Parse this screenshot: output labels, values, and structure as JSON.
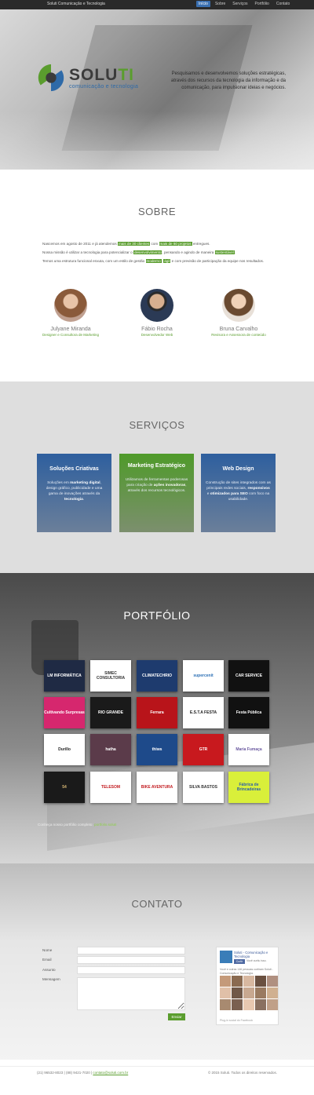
{
  "navbar": {
    "brand": "Soluti Comunicação e Tecnologia",
    "items": [
      "Início",
      "Sobre",
      "Serviços",
      "Portfólio",
      "Contato"
    ],
    "active_index": 0
  },
  "hero": {
    "logo_name_main": "SOLU",
    "logo_name_accent": "TI",
    "logo_tagline": "comunicação e tecnologia",
    "tagline": "Pesquisamos e desenvolvemos soluções estratégicas, através dos recursos da tecnologia da informação e da comunicação, para impulsionar ideias e negócios."
  },
  "sobre": {
    "title": "SOBRE",
    "p1_a": "Nascemos em agosto de 2011 e já atendemos ",
    "p1_hl1": "mais de 30 clientes",
    "p1_b": " com ",
    "p1_hl2": "mais de 60 projetos",
    "p1_c": " entregues.",
    "p2_a": "Nossa missão é utilizar a tecnologia para potencializar o ",
    "p2_hl1": "desenvolvimento",
    "p2_b": ", pensando e agindo de maneira ",
    "p2_hl2": "sustentável",
    "p2_c": ".",
    "p3_a": "Temos uma estrutura funcional enxuta, com um estilo de gestão ",
    "p3_hl1": "moderno",
    "p3_b": ", ",
    "p3_hl2": "ágil",
    "p3_c": " e com previsão de participação da equipe nos resultados.",
    "team": [
      {
        "name": "Julyane Miranda",
        "role": "Designer e Consultora de Marketing"
      },
      {
        "name": "Fábio Rocha",
        "role": "Desenvolvedor Web"
      },
      {
        "name": "Bruna Carvalho",
        "role": "Revisora e Assessora de conteúdo"
      }
    ]
  },
  "servicos": {
    "title": "SERVIÇOS",
    "cards": [
      {
        "title": "Soluções Criativas",
        "t1": "Soluções em ",
        "b1": "marketing digital",
        "t2": ", design gráfico, publicidade e uma gama de inovações através da ",
        "b2": "tecnologia",
        "t3": ".",
        "color": "#3b6ba3"
      },
      {
        "title": "Marketing Estratégico",
        "t1": "Utilizamos de ferramentas poderosas para criação de ",
        "b1": "ações inovadoras",
        "t2": ", através dos recursos tecnológicos.",
        "b2": "",
        "t3": "",
        "color": "#5a9d2e"
      },
      {
        "title": "Web Design",
        "t1": "Construção de sites integrados com as principais redes sociais, ",
        "b1": "responsivos",
        "t2": " e ",
        "b2": "otimizados para SEO",
        "t3": " com foco na usabilidade.",
        "color": "#3b6ba3"
      }
    ]
  },
  "portfolio": {
    "title": "PORTFÓLIO",
    "tiles": [
      {
        "label": "LM INFORMÁTICA",
        "bg": "#1f2a44",
        "fg": "#fff"
      },
      {
        "label": "SIMEC CONSULTORIA",
        "bg": "#ffffff",
        "fg": "#333"
      },
      {
        "label": "CLIMATECHRIO",
        "bg": "#1e3b6e",
        "fg": "#fff"
      },
      {
        "label": "supercenit",
        "bg": "#ffffff",
        "fg": "#2b6fb5"
      },
      {
        "label": "CAR SERVICE",
        "bg": "#111111",
        "fg": "#fff"
      },
      {
        "label": "Cultivando Surpresas",
        "bg": "#d6276e",
        "fg": "#fff"
      },
      {
        "label": "RIO GRANDE",
        "bg": "#1a1a1a",
        "fg": "#fff"
      },
      {
        "label": "Ferrara",
        "bg": "#b8141a",
        "fg": "#fff"
      },
      {
        "label": "E.S.T.A FESTA",
        "bg": "#ffffff",
        "fg": "#222"
      },
      {
        "label": "Festa Pública",
        "bg": "#111111",
        "fg": "#fff"
      },
      {
        "label": "Durillo",
        "bg": "#ffffff",
        "fg": "#222"
      },
      {
        "label": "hatha",
        "bg": "#5b3b4a",
        "fg": "#fff"
      },
      {
        "label": "thiws",
        "bg": "#1e4a8a",
        "fg": "#fff"
      },
      {
        "label": "GTR",
        "bg": "#c8191e",
        "fg": "#fff"
      },
      {
        "label": "Maria Fumaça",
        "bg": "#ffffff",
        "fg": "#6b5aa0"
      },
      {
        "label": "54",
        "bg": "#1a1a1a",
        "fg": "#d8b875"
      },
      {
        "label": "TELESOM",
        "bg": "#ffffff",
        "fg": "#c21a1f"
      },
      {
        "label": "BIKE AVENTURA",
        "bg": "#ffffff",
        "fg": "#c21a1f"
      },
      {
        "label": "SILVA BASTOS",
        "bg": "#ffffff",
        "fg": "#333"
      },
      {
        "label": "Fábrica de Brincadeiras",
        "bg": "#d9ef3a",
        "fg": "#2b5fa8"
      }
    ],
    "note_a": "Conheça nosso portfólio completo: ",
    "note_link": "portfolio.soluti"
  },
  "contato": {
    "title": "CONTATO",
    "labels": {
      "nome": "Nome",
      "email": "Email",
      "assunto": "Assunto",
      "mensagem": "Mensagem"
    },
    "submit": "Enviar",
    "fb": {
      "title": "Soluti - Comunicação e Tecnologia",
      "like": "Curtir",
      "likes": "Você curtiu isso.",
      "sub": "Você e outras 146 pessoas curtiram Soluti - Comunicação e Tecnologia.",
      "plugin": "Plug-in social do Facebook"
    }
  },
  "footer": {
    "left_a": "(21) 96532-8023 | (88) 9421-7020 | ",
    "left_link": "contato@soluti.com.br",
    "right": "© 2015 Soluti. Todos os direitos reservados."
  }
}
